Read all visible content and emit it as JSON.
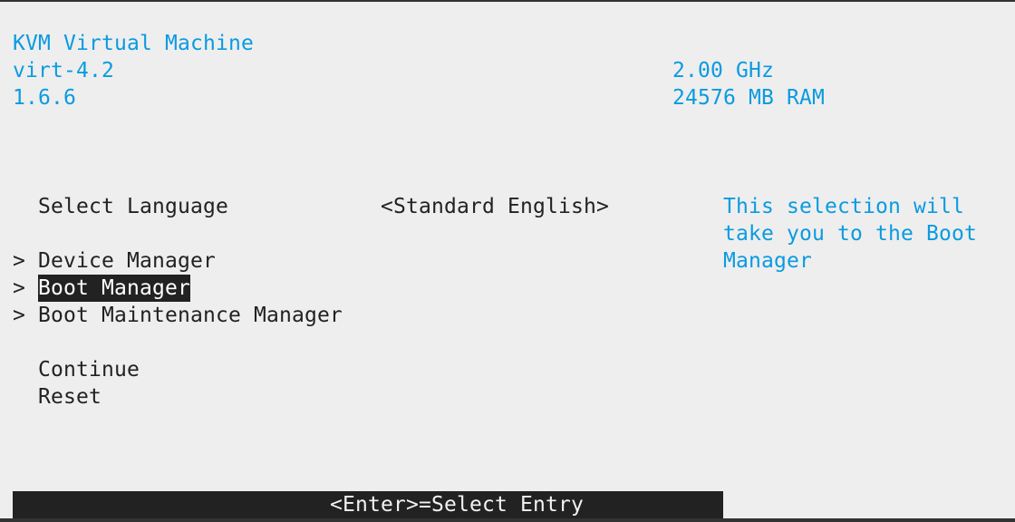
{
  "system_info": {
    "platform": "KVM Virtual Machine",
    "machine_type": "virt-4.2",
    "firmware_version": "1.6.6",
    "cpu_speed": "2.00 GHz",
    "memory": "24576 MB RAM"
  },
  "menu": {
    "language_label": "Select Language",
    "language_value": "<Standard English>",
    "submenu_marker": ">",
    "items": [
      {
        "label": "Device Manager",
        "submenu": true
      },
      {
        "label": "Boot Manager",
        "submenu": true,
        "selected": true
      },
      {
        "label": "Boot Maintenance Manager",
        "submenu": true
      },
      {
        "label": "Continue"
      },
      {
        "label": "Reset"
      }
    ]
  },
  "help": {
    "lines": [
      "This selection will",
      "take you to the Boot",
      "Manager"
    ]
  },
  "status_bar": {
    "text": "<Enter>=Select Entry"
  },
  "colors": {
    "info_text": "#0a9be0",
    "background": "#eeeeee",
    "highlight": "#222222"
  }
}
